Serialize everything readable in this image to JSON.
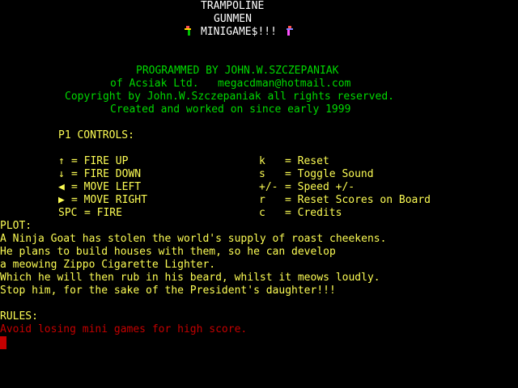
{
  "title": {
    "line1": "TRAMPOLINE",
    "line2": "GUNMEN",
    "line3": "MINIGAME$!!!"
  },
  "credits": {
    "line1": "PROGRAMMED BY JOHN.W.SZCZEPANIAK",
    "line2": "of Acsiak Ltd.   megacdman@hotmail.com",
    "line3": "Copyright by John.W.Szczepaniak all rights reserved.",
    "line4": "Created and worked on since early 1999"
  },
  "controls": {
    "heading": "P1 CONTROLS:",
    "left": [
      {
        "key": "↑",
        "label": "= FIRE UP"
      },
      {
        "key": "↓",
        "label": "= FIRE DOWN"
      },
      {
        "key": "◀",
        "label": "= MOVE LEFT"
      },
      {
        "key": "▶",
        "label": "= MOVE RIGHT"
      },
      {
        "key": "SPC",
        "label": "= FIRE"
      }
    ],
    "right": [
      {
        "key": "k",
        "label": "= Reset"
      },
      {
        "key": "s",
        "label": "= Toggle Sound"
      },
      {
        "key": "+/-",
        "label": "= Speed +/-"
      },
      {
        "key": "r",
        "label": "= Reset Scores on Board"
      },
      {
        "key": "c",
        "label": "= Credits"
      }
    ]
  },
  "plot": {
    "heading": "PLOT:",
    "lines": [
      "A Ninja Goat has stolen the world's supply of roast cheekens.",
      "He plans to build houses with them, so he can develop",
      "a meowing Zippo Cigarette Lighter.",
      "Which he will then rub in his beard, whilst it meows loudly.",
      "Stop him, for the sake of the President's daughter!!!"
    ]
  },
  "rules": {
    "heading": "RULES:",
    "text": "Avoid losing mini games for high score."
  },
  "colors": {
    "background": "#000000",
    "title": "#ffffff",
    "credits": "#00d800",
    "body": "#fcfc54",
    "rules_text": "#c40000"
  },
  "icons": [
    "gunman-left-icon",
    "gunman-right-icon",
    "text-cursor"
  ]
}
